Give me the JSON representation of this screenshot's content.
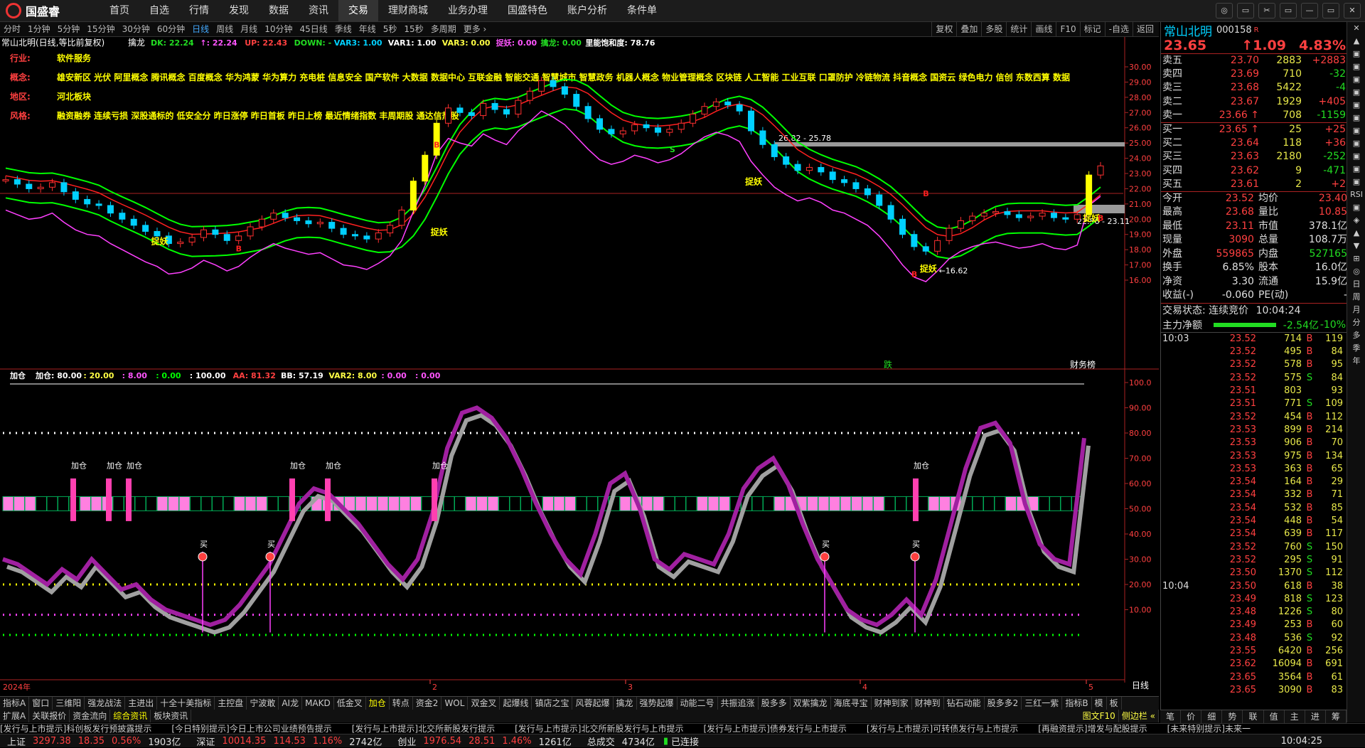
{
  "app": {
    "logo": "国盛睿"
  },
  "menu": [
    "首页",
    "自选",
    "行情",
    "发现",
    "数据",
    "资讯",
    "交易",
    "理财商城",
    "业务办理",
    "国盛特色",
    "账户分析",
    "条件单"
  ],
  "menu_active": 6,
  "window_controls": [
    "◎",
    "▭",
    "✂",
    "▭",
    "—",
    "▭",
    "✕"
  ],
  "periods": [
    "分时",
    "1分钟",
    "5分钟",
    "15分钟",
    "30分钟",
    "60分钟",
    "日线",
    "周线",
    "月线",
    "10分钟",
    "45日线",
    "季线",
    "年线",
    "5秒",
    "15秒",
    "多周期",
    "更多 ›"
  ],
  "period_active": 6,
  "right_tools": [
    "复权",
    "叠加",
    "多股",
    "统计",
    "画线",
    "F10",
    "标记",
    "-自选",
    "返回"
  ],
  "main_chart": {
    "title": "常山北明(日线,等比前复权)",
    "indicator_name": "擒龙",
    "legend": [
      {
        "text": "DK: 22.24",
        "color": "#22dd22"
      },
      {
        "text": "↑: 22.24",
        "color": "#ff55ff"
      },
      {
        "text": "UP: 22.43",
        "color": "#ff4040"
      },
      {
        "text": "DOWN: -",
        "color": "#22dd22"
      },
      {
        "text": "VAR3: 1.00",
        "color": "#00d0ff"
      },
      {
        "text": "VAR1: 1.00",
        "color": "#ffffff"
      },
      {
        "text": "VAR3: 0.00",
        "color": "#ffff44"
      },
      {
        "text": "捉妖: 0.00",
        "color": "#ff55ff"
      },
      {
        "text": "擒龙: 0.00",
        "color": "#22dd22"
      },
      {
        "text": "里能饱和度: 78.76",
        "color": "#ffffff"
      }
    ],
    "info": [
      {
        "label": "行业:",
        "value": "软件服务"
      },
      {
        "label": "概念:",
        "value": "雄安新区 光伏 阿里概念 腾讯概念 百度概念 华为鸿蒙 华为算力 充电桩 信息安全 国产软件 大数据 数据中心 互联金融 智能交通 智慧城市 智慧政务 机器人概念 物业管理概念 区块链 人工智能 工业互联 口罩防护 冷链物流 抖音概念 国资云 绿色电力 信创 东数西算 数据"
      },
      {
        "label": "地区:",
        "value": "河北板块"
      },
      {
        "label": "风格:",
        "value": "融资融券 连续亏损 深股通标的 低安全分 昨日涨停 昨日首板 昨日上榜 最近情绪指数 丰周期股 通达信热股"
      }
    ],
    "marks": {
      "high": "26.82 - 25.78",
      "right": "22.56 - 23.11",
      "low": "16.62",
      "zhuoyao": "捉妖",
      "die": "跌",
      "caiwu": "财务榜",
      "b": "B",
      "s": "S"
    },
    "axis_ticks": [
      "30.00",
      "29.00",
      "28.00",
      "27.00",
      "26.00",
      "25.00",
      "24.00",
      "23.00",
      "22.00",
      "21.00",
      "20.00",
      "19.00",
      "18.00",
      "17.00",
      "16.00"
    ],
    "colors": {
      "up": "#ff3030",
      "down": "#00d0ff",
      "limit": "#ffff00",
      "line1": "#00ff00",
      "line2": "#ff2020",
      "line3": "#ff40ff"
    }
  },
  "sub_chart": {
    "name": "加仓",
    "legend": [
      {
        "text": "加仓: 80.00",
        "color": "#ffffff"
      },
      {
        "text": ": 20.00",
        "color": "#ffff44"
      },
      {
        "text": ": 8.00",
        "color": "#ff55ff"
      },
      {
        "text": ": 0.00",
        "color": "#00ff00"
      },
      {
        "text": ": 100.00",
        "color": "#ffffff"
      },
      {
        "text": "AA: 81.32",
        "color": "#ff4040"
      },
      {
        "text": "BB: 57.19",
        "color": "#ffffff"
      },
      {
        "text": "VAR2: 8.00",
        "color": "#ffff44"
      },
      {
        "text": ": 0.00",
        "color": "#ff55ff"
      },
      {
        "text": ": 0.00",
        "color": "#ff55ff"
      }
    ],
    "labels": {
      "jiacang": "加仓",
      "mai": "买"
    },
    "axis_ticks": [
      "100.0",
      "90.00",
      "80.00",
      "70.00",
      "60.00",
      "50.00",
      "40.00",
      "30.00",
      "20.00",
      "10.00"
    ]
  },
  "time_axis": {
    "year": "2024年",
    "months": [
      "2",
      "3",
      "4",
      "5"
    ],
    "period_label": "日线"
  },
  "tabs1": [
    "指标A",
    "窗口",
    "三维阳",
    "强龙战法",
    "主进出",
    "十全十美指标",
    "主控盘",
    "宁波敢",
    "AI龙",
    "MAKD",
    "低金叉",
    "加仓",
    "转点",
    "资金2",
    "WOL",
    "双金叉",
    "起爆线",
    "镇店之宝",
    "风蓉起爆",
    "擒龙",
    "强势起爆",
    "动能二号",
    "共振追涨",
    "股多多",
    "双紫擒龙",
    "海底寻宝",
    "财神到家",
    "财神到",
    "钻石动能",
    "股多多2",
    "三红一紫",
    "指标B",
    "模",
    "板"
  ],
  "tabs1_active": 11,
  "tabs2": [
    "扩展A",
    "关联报价",
    "资金流向",
    "综合资讯",
    "板块资讯"
  ],
  "tabs2_active": 3,
  "tabs2_right": [
    "图文F10",
    "侧边栏 «"
  ],
  "news": [
    "[发行与上市提示]科创板发行预披露提示",
    "[今日特别提示]今日上市公司业绩预告提示",
    "[发行与上市提示]北交所新股发行提示",
    "[发行与上市提示]北交所新股发行与上市提示",
    "[发行与上市提示]债券发行与上市提示",
    "[发行与上市提示]可转债发行与上市提示",
    "[再融资提示]增发与配股提示",
    "[未来特别提示]未来一"
  ],
  "status": {
    "sh_name": "上证",
    "sh_val": "3297.38",
    "sh_chg": "18.35",
    "sh_pct": "0.56%",
    "sh_amt": "1903亿",
    "sz_name": "深证",
    "sz_val": "10014.35",
    "sz_chg": "114.53",
    "sz_pct": "1.16%",
    "sz_amt": "2742亿",
    "cy_name": "创业",
    "cy_val": "1976.54",
    "cy_chg": "28.51",
    "cy_pct": "1.46%",
    "cy_amt": "1261亿",
    "total_label": "总成交",
    "total": "4734亿",
    "conn": "已连接",
    "time": "10:04:25"
  },
  "quote": {
    "name": "常山北明",
    "code": "000158",
    "flag": "R",
    "price": "23.65",
    "chg": "↑1.09",
    "pct": "4.83%",
    "asks": [
      {
        "label": "卖五",
        "price": "23.70",
        "vol": "2883",
        "d": "+2883",
        "dc": "red"
      },
      {
        "label": "卖四",
        "price": "23.69",
        "vol": "710",
        "d": "-32",
        "dc": "grn"
      },
      {
        "label": "卖三",
        "price": "23.68",
        "vol": "5422",
        "d": "-4",
        "dc": "grn"
      },
      {
        "label": "卖二",
        "price": "23.67",
        "vol": "1929",
        "d": "+405",
        "dc": "red"
      },
      {
        "label": "卖一",
        "price": "23.66 ↑",
        "vol": "708",
        "d": "-1159",
        "dc": "grn"
      }
    ],
    "bids": [
      {
        "label": "买一",
        "price": "23.65 ↑",
        "vol": "25",
        "d": "+25",
        "dc": "red"
      },
      {
        "label": "买二",
        "price": "23.64",
        "vol": "118",
        "d": "+36",
        "dc": "red"
      },
      {
        "label": "买三",
        "price": "23.63",
        "vol": "2180",
        "d": "-252",
        "dc": "grn"
      },
      {
        "label": "买四",
        "price": "23.62",
        "vol": "9",
        "d": "-471",
        "dc": "grn"
      },
      {
        "label": "买五",
        "price": "23.61",
        "vol": "2",
        "d": "+2",
        "dc": "red"
      }
    ],
    "stats": [
      {
        "k1": "今开",
        "v1": "23.52",
        "c1": "red",
        "k2": "均价",
        "v2": "23.40",
        "c2": "red"
      },
      {
        "k1": "最高",
        "v1": "23.68",
        "c1": "red",
        "k2": "量比",
        "v2": "10.85",
        "c2": "red"
      },
      {
        "k1": "最低",
        "v1": "23.11",
        "c1": "red",
        "k2": "市值",
        "v2": "378.1亿",
        "c2": "wht"
      },
      {
        "k1": "现量",
        "v1": "3090",
        "c1": "red",
        "k2": "总量",
        "v2": "108.7万",
        "c2": "wht"
      },
      {
        "k1": "外盘",
        "v1": "559865",
        "c1": "red",
        "k2": "内盘",
        "v2": "527165",
        "c2": "grn"
      },
      {
        "k1": "换手",
        "v1": "6.85%",
        "c1": "wht",
        "k2": "股本",
        "v2": "16.0亿",
        "c2": "wht"
      },
      {
        "k1": "净资",
        "v1": "3.30",
        "c1": "wht",
        "k2": "流通",
        "v2": "15.9亿",
        "c2": "wht"
      },
      {
        "k1": "收益(-)",
        "v1": "-0.060",
        "c1": "wht",
        "k2": "PE(动)",
        "v2": "-",
        "c2": "wht"
      }
    ],
    "trade_state_label": "交易状态:",
    "trade_state": "连续竞价",
    "trade_time": "10:04:24",
    "main_label": "主力净额",
    "main_val": "-2.54亿",
    "main_pct": "-10%",
    "ticks_t1": "10:03",
    "ticks": [
      [
        "23.52",
        "714",
        "B",
        "119"
      ],
      [
        "23.52",
        "495",
        "B",
        "84"
      ],
      [
        "23.52",
        "578",
        "B",
        "95"
      ],
      [
        "23.52",
        "575",
        "S",
        "84"
      ],
      [
        "23.51",
        "803",
        "",
        "93"
      ],
      [
        "23.51",
        "771",
        "S",
        "109"
      ],
      [
        "23.52",
        "454",
        "B",
        "112"
      ],
      [
        "23.53",
        "899",
        "B",
        "214"
      ],
      [
        "23.53",
        "906",
        "B",
        "70"
      ],
      [
        "23.53",
        "975",
        "B",
        "134"
      ],
      [
        "23.53",
        "363",
        "B",
        "65"
      ],
      [
        "23.54",
        "164",
        "B",
        "29"
      ],
      [
        "23.54",
        "332",
        "B",
        "71"
      ],
      [
        "23.54",
        "532",
        "B",
        "85"
      ],
      [
        "23.54",
        "448",
        "B",
        "54"
      ],
      [
        "23.54",
        "639",
        "B",
        "117"
      ],
      [
        "23.52",
        "760",
        "S",
        "150"
      ],
      [
        "23.52",
        "295",
        "S",
        "91"
      ],
      [
        "23.50",
        "1370",
        "S",
        "112"
      ]
    ],
    "ticks_t2": "10:04",
    "ticks2": [
      [
        "23.50",
        "618",
        "B",
        "38"
      ],
      [
        "23.49",
        "818",
        "S",
        "123"
      ],
      [
        "23.48",
        "1226",
        "S",
        "80"
      ],
      [
        "23.49",
        "253",
        "B",
        "60"
      ],
      [
        "23.48",
        "536",
        "S",
        "92"
      ],
      [
        "23.55",
        "6420",
        "B",
        "256"
      ],
      [
        "23.62",
        "16094",
        "B",
        "691"
      ],
      [
        "23.65",
        "3564",
        "B",
        "61"
      ],
      [
        "23.65",
        "3090",
        "B",
        "83"
      ]
    ],
    "tabs": [
      "笔",
      "价",
      "细",
      "势",
      "联",
      "值",
      "主",
      "进",
      "筹"
    ]
  },
  "side_buttons": [
    "✕",
    "▲",
    "▣",
    "▣",
    "▣",
    "▣",
    "▣",
    "▣",
    "▣",
    "▣",
    "▣",
    "▣",
    "▣",
    "RSI",
    "▣",
    "◈",
    "▲",
    "▼",
    "⊞",
    "◎",
    "日",
    "周",
    "月",
    "分",
    "多",
    "季",
    "年"
  ]
}
